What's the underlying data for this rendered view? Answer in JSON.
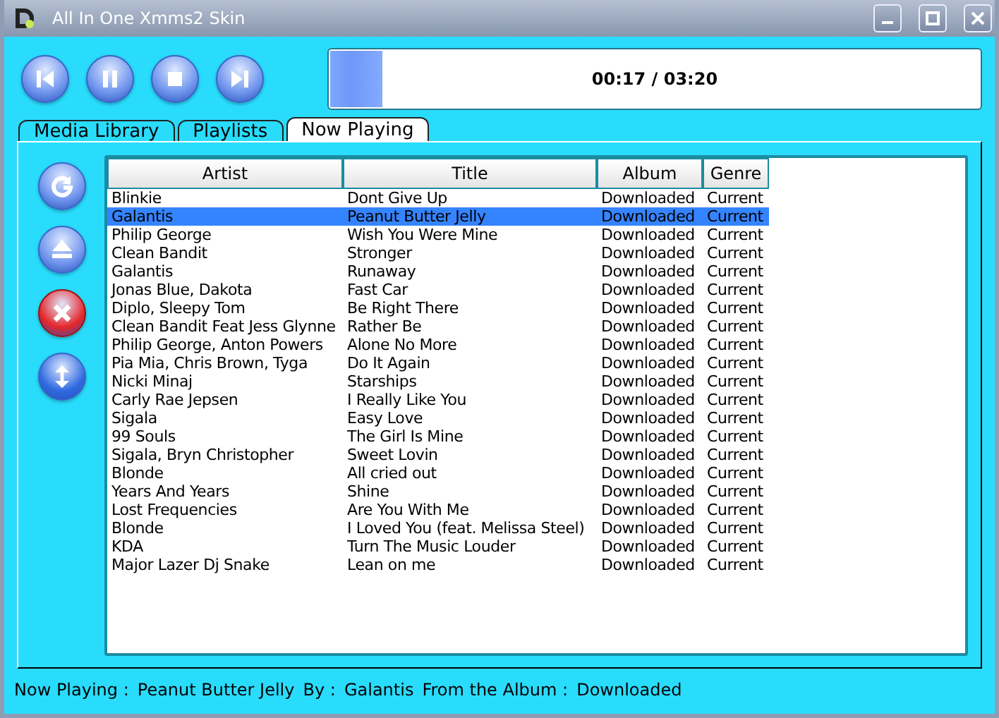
{
  "window": {
    "title": "All In One Xmms2 Skin"
  },
  "transport": [
    {
      "kind": "previous"
    },
    {
      "kind": "pause"
    },
    {
      "kind": "stop"
    },
    {
      "kind": "next"
    }
  ],
  "progress": {
    "level": 0.08,
    "time": "00:17 / 03:20"
  },
  "tabs": [
    {
      "label": "Media Library",
      "selected": false
    },
    {
      "label": "Playlists",
      "selected": false
    },
    {
      "label": "Now Playing",
      "selected": true
    }
  ],
  "side_buttons": [
    {
      "kind": "refresh"
    },
    {
      "kind": "eject"
    },
    {
      "kind": "remove"
    },
    {
      "kind": "move"
    }
  ],
  "table": {
    "columns": [
      "Artist",
      "Title",
      "Album",
      "Genre"
    ],
    "rows": [
      {
        "cells": [
          "Blinkie",
          "Dont Give Up",
          "Downloaded",
          "Current"
        ],
        "selected": false
      },
      {
        "cells": [
          "Galantis",
          "Peanut Butter Jelly",
          "Downloaded",
          "Current"
        ],
        "selected": true
      },
      {
        "cells": [
          "Philip George",
          "Wish You Were Mine",
          "Downloaded",
          "Current"
        ],
        "selected": false
      },
      {
        "cells": [
          "Clean Bandit",
          "Stronger",
          "Downloaded",
          "Current"
        ],
        "selected": false
      },
      {
        "cells": [
          "Galantis",
          "Runaway",
          "Downloaded",
          "Current"
        ],
        "selected": false
      },
      {
        "cells": [
          "Jonas Blue, Dakota",
          "Fast Car",
          "Downloaded",
          "Current"
        ],
        "selected": false
      },
      {
        "cells": [
          "Diplo, Sleepy Tom",
          "Be Right There",
          "Downloaded",
          "Current"
        ],
        "selected": false
      },
      {
        "cells": [
          "Clean Bandit Feat Jess Glynne",
          "Rather Be",
          "Downloaded",
          "Current"
        ],
        "selected": false
      },
      {
        "cells": [
          "Philip George, Anton Powers",
          "Alone No More",
          "Downloaded",
          "Current"
        ],
        "selected": false
      },
      {
        "cells": [
          "Pia Mia, Chris Brown, Tyga",
          "Do It Again",
          "Downloaded",
          "Current"
        ],
        "selected": false
      },
      {
        "cells": [
          "Nicki Minaj",
          "Starships",
          "Downloaded",
          "Current"
        ],
        "selected": false
      },
      {
        "cells": [
          "Carly Rae Jepsen",
          "I Really Like You",
          "Downloaded",
          "Current"
        ],
        "selected": false
      },
      {
        "cells": [
          "Sigala",
          "Easy Love",
          "Downloaded",
          "Current"
        ],
        "selected": false
      },
      {
        "cells": [
          "99 Souls",
          "The Girl Is Mine",
          "Downloaded",
          "Current"
        ],
        "selected": false
      },
      {
        "cells": [
          "Sigala, Bryn Christopher",
          "Sweet Lovin",
          "Downloaded",
          "Current"
        ],
        "selected": false
      },
      {
        "cells": [
          "Blonde",
          "All cried out",
          "Downloaded",
          "Current"
        ],
        "selected": false
      },
      {
        "cells": [
          "Years And Years",
          "Shine",
          "Downloaded",
          "Current"
        ],
        "selected": false
      },
      {
        "cells": [
          "Lost Frequencies",
          "Are You With Me",
          "Downloaded",
          "Current"
        ],
        "selected": false
      },
      {
        "cells": [
          "Blonde",
          "I Loved You (feat. Melissa Steel)",
          "Downloaded",
          "Current"
        ],
        "selected": false
      },
      {
        "cells": [
          "KDA",
          "Turn The Music Louder",
          "Downloaded",
          "Current"
        ],
        "selected": false
      },
      {
        "cells": [
          "Major Lazer Dj Snake",
          "Lean on me",
          "Downloaded",
          "Current"
        ],
        "selected": false
      }
    ]
  },
  "status_bar": [
    {
      "label": "Now Playing :",
      "value": "Peanut Butter Jelly"
    },
    {
      "label": "By :",
      "value": "Galantis"
    },
    {
      "label": "From the Album :",
      "value": "Downloaded"
    }
  ]
}
